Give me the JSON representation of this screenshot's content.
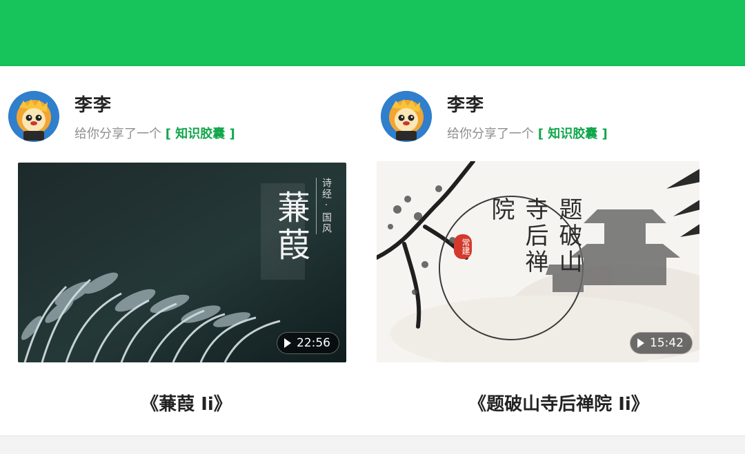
{
  "cards": [
    {
      "user": {
        "name": "李李"
      },
      "share": {
        "prefix": "给你分享了一个",
        "tag": "[ 知识胶囊 ]"
      },
      "thumb": {
        "title": "蒹葭",
        "subtitle": "诗经·国风",
        "duration": "22:56"
      },
      "caption": "《蒹葭 Ⅰi》"
    },
    {
      "user": {
        "name": "李李"
      },
      "share": {
        "prefix": "给你分享了一个",
        "tag": "[ 知识胶囊 ]"
      },
      "thumb": {
        "title": "题破山寺后禅院",
        "seal": "常建",
        "duration": "15:42"
      },
      "caption": "《题破山寺后禅院 Ⅰi》"
    }
  ],
  "colors": {
    "topbar": "#16c45b",
    "accent": "#10a64a"
  },
  "icons": {
    "play": "play-icon",
    "avatar": "lion-avatar-icon"
  }
}
